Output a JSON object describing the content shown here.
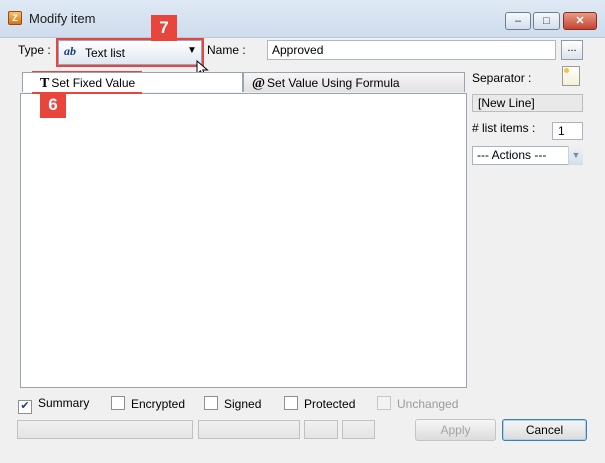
{
  "window": {
    "title": "Modify item",
    "icon": "app-icon",
    "controls": {
      "minimize": "–",
      "maximize": "□",
      "close": "✕"
    }
  },
  "type_field": {
    "label": "Type :",
    "icon_text": "ab",
    "value": "Text list",
    "arrow": "▼"
  },
  "name_field": {
    "label": "Name :",
    "value": "Approved",
    "more_label": "..."
  },
  "annotations": {
    "badge_7": "7",
    "badge_6": "6",
    "color": "#e8453c"
  },
  "tabs": [
    {
      "glyph": "T",
      "label": "Set Fixed Value",
      "active": true
    },
    {
      "glyph": "@",
      "label": "Set Value Using Formula",
      "active": false
    }
  ],
  "side_panel": {
    "separator_label": "Separator :",
    "separator_value": "[New Line]",
    "list_items_label": "# list items :",
    "list_items_count": "1",
    "actions_value": "--- Actions ---",
    "actions_arrow": "▼"
  },
  "checkboxes": [
    {
      "label": "Summary",
      "checked": true,
      "check_mark": "✔"
    },
    {
      "label": "Encrypted",
      "checked": false
    },
    {
      "label": "Signed",
      "checked": false
    },
    {
      "label": "Protected",
      "checked": false
    },
    {
      "label": "Unchanged",
      "checked": false,
      "disabled": true
    }
  ],
  "buttons": {
    "apply": "Apply",
    "cancel": "Cancel"
  }
}
